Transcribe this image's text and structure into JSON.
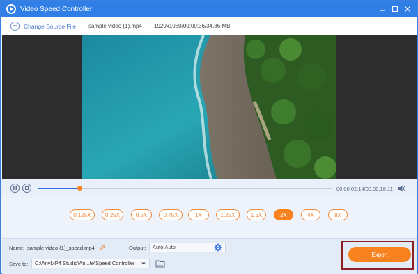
{
  "window": {
    "title": "Video Speed Controller"
  },
  "source": {
    "change_label": "Change Source File",
    "file_name": "sample video (1).mp4",
    "file_meta": "1920x1080/00:00:36/34.86 MB"
  },
  "playback": {
    "current_time": "00:00:02.14",
    "total_time": "00:00:18.11",
    "time_display": "00:00:02.14/00:00:18.11",
    "progress": 0.14
  },
  "speeds": [
    {
      "label": "0.125X",
      "active": false
    },
    {
      "label": "0.25X",
      "active": false
    },
    {
      "label": "0.5X",
      "active": false
    },
    {
      "label": "0.75X",
      "active": false
    },
    {
      "label": "1X",
      "active": false
    },
    {
      "label": "1.25X",
      "active": false
    },
    {
      "label": "1.5X",
      "active": false
    },
    {
      "label": "2X",
      "active": true
    },
    {
      "label": "4X",
      "active": false
    },
    {
      "label": "8X",
      "active": false
    }
  ],
  "output": {
    "name_label": "Name:",
    "name_value": "sample video (1)_speed.mp4",
    "output_label": "Output:",
    "output_value": "Auto;Auto",
    "saveto_label": "Save to:",
    "saveto_value": "C:\\AnyMP4 Studio\\An...te\\Speed Controller",
    "export_label": "Export"
  },
  "colors": {
    "titlebar": "#2f7fe7",
    "accent_orange": "#f7821f",
    "highlight_border": "#8b1f24"
  }
}
